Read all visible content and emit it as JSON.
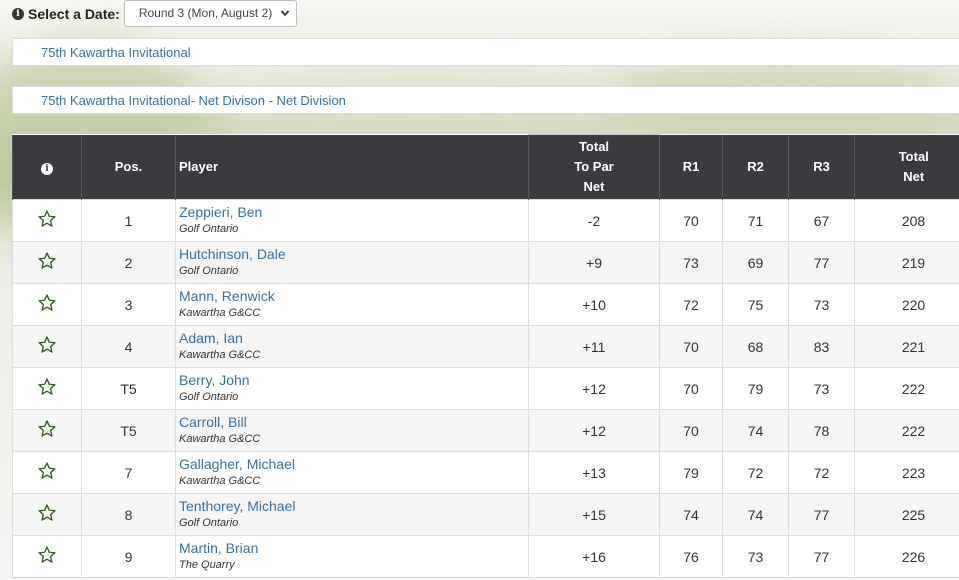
{
  "selector": {
    "label": "Select a Date:",
    "selected": "Round 3 (Mon, August 2)"
  },
  "tournament_link": "75th Kawartha Invitational",
  "division_link": "75th Kawartha Invitational- Net Divison - Net Division",
  "columns": {
    "info": "",
    "pos": "Pos.",
    "player": "Player",
    "topar_1": "Total",
    "topar_2": "To Par",
    "topar_3": "Net",
    "r1": "R1",
    "r2": "R2",
    "r3": "R3",
    "total_1": "Total",
    "total_2": "Net"
  },
  "rows": [
    {
      "pos": "1",
      "name": "Zeppieri, Ben",
      "club": "Golf Ontario",
      "topar": "-2",
      "r1": "70",
      "r2": "71",
      "r3": "67",
      "total": "208"
    },
    {
      "pos": "2",
      "name": "Hutchinson, Dale",
      "club": "Golf Ontario",
      "topar": "+9",
      "r1": "73",
      "r2": "69",
      "r3": "77",
      "total": "219"
    },
    {
      "pos": "3",
      "name": "Mann, Renwick",
      "club": "Kawartha G&CC",
      "topar": "+10",
      "r1": "72",
      "r2": "75",
      "r3": "73",
      "total": "220"
    },
    {
      "pos": "4",
      "name": "Adam, Ian",
      "club": "Kawartha G&CC",
      "topar": "+11",
      "r1": "70",
      "r2": "68",
      "r3": "83",
      "total": "221"
    },
    {
      "pos": "T5",
      "name": "Berry, John",
      "club": "Golf Ontario",
      "topar": "+12",
      "r1": "70",
      "r2": "79",
      "r3": "73",
      "total": "222"
    },
    {
      "pos": "T5",
      "name": "Carroll, Bill",
      "club": "Kawartha G&CC",
      "topar": "+12",
      "r1": "70",
      "r2": "74",
      "r3": "78",
      "total": "222"
    },
    {
      "pos": "7",
      "name": "Gallagher, Michael",
      "club": "Kawartha G&CC",
      "topar": "+13",
      "r1": "79",
      "r2": "72",
      "r3": "72",
      "total": "223"
    },
    {
      "pos": "8",
      "name": "Tenthorey, Michael",
      "club": "Golf Ontario",
      "topar": "+15",
      "r1": "74",
      "r2": "74",
      "r3": "77",
      "total": "225"
    },
    {
      "pos": "9",
      "name": "Martin, Brian",
      "club": "The Quarry",
      "topar": "+16",
      "r1": "76",
      "r2": "73",
      "r3": "77",
      "total": "226"
    }
  ],
  "colors": {
    "header_bg": "#3b3a3f",
    "link": "#3a6f9a",
    "star": "#2f5a1a"
  },
  "icons": {
    "info": "info-circle-icon",
    "favorite": "star-outline-icon",
    "dropdown": "chevron-down-icon"
  }
}
